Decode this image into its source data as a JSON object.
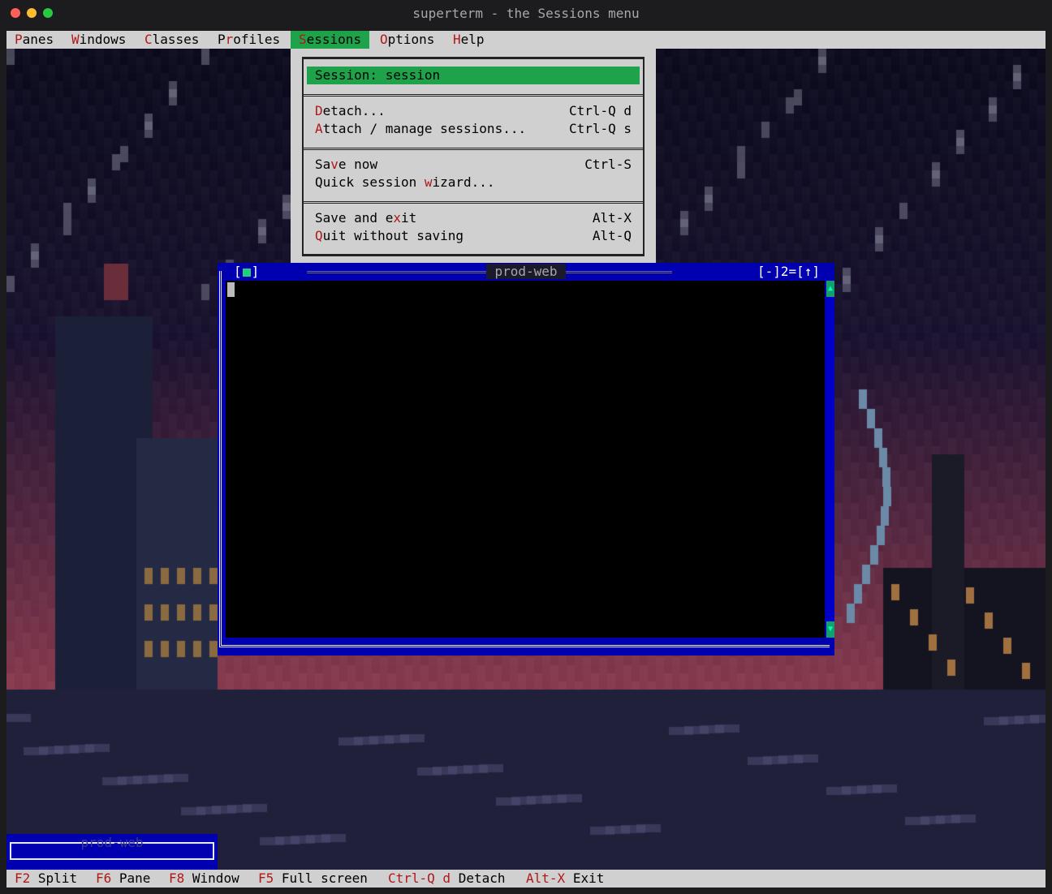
{
  "window": {
    "title": "superterm - the Sessions menu"
  },
  "menubar": {
    "items": [
      {
        "pre": "",
        "hot": "P",
        "post": "anes"
      },
      {
        "pre": "",
        "hot": "W",
        "post": "indows"
      },
      {
        "pre": "",
        "hot": "C",
        "post": "lasses"
      },
      {
        "pre": "P",
        "hot": "r",
        "post": "ofiles"
      },
      {
        "pre": "",
        "hot": "S",
        "post": "essions"
      },
      {
        "pre": "",
        "hot": "O",
        "post": "ptions"
      },
      {
        "pre": "",
        "hot": "H",
        "post": "elp"
      }
    ],
    "active_index": 4
  },
  "sessions_menu": {
    "header": "Session: session",
    "items": [
      {
        "pre": "",
        "hot": "D",
        "post": "etach...",
        "shortcut": "Ctrl-Q d"
      },
      {
        "pre": "",
        "hot": "A",
        "post": "ttach / manage sessions...",
        "shortcut": "Ctrl-Q s"
      },
      {
        "pre": "Sa",
        "hot": "v",
        "post": "e now",
        "shortcut": "Ctrl-S"
      },
      {
        "pre": "Quick session ",
        "hot": "w",
        "post": "izard...",
        "shortcut": ""
      },
      {
        "pre": "Save and e",
        "hot": "x",
        "post": "it",
        "shortcut": "Alt-X"
      },
      {
        "pre": "",
        "hot": "Q",
        "post": "uit without saving",
        "shortcut": "Alt-Q"
      }
    ]
  },
  "pane_window": {
    "title": "prod-web",
    "close_left": "[",
    "close_right": "]",
    "controls": "[-]2=[↑]",
    "scroll_up": "▲",
    "scroll_down": "▼"
  },
  "minimized_window": {
    "title": "prod-web"
  },
  "statusbar": [
    {
      "key": "F2",
      "label": "Split"
    },
    {
      "key": "F6",
      "label": "Pane"
    },
    {
      "key": "F8",
      "label": "Window"
    },
    {
      "key": "F5",
      "label": "Full screen"
    },
    {
      "key": "Ctrl-Q d",
      "label": "Detach"
    },
    {
      "key": "Alt-X",
      "label": "Exit"
    }
  ],
  "colors": {
    "menu_bg": "#d0d0d0",
    "accent_green": "#1fa34a",
    "hotkey_red": "#b01818",
    "window_blue": "#0000b0"
  }
}
